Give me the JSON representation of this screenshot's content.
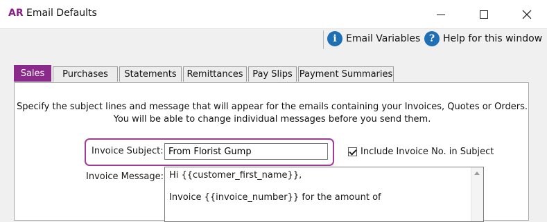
{
  "window": {
    "app_logo": "AR",
    "title": "Email Defaults"
  },
  "toolbar": {
    "email_variables_label": "Email Variables",
    "email_variables_icon": "info-icon",
    "help_label": "Help for this window",
    "help_icon": "question-icon"
  },
  "tabs": [
    {
      "label": "Sales",
      "active": true
    },
    {
      "label": "Purchases"
    },
    {
      "label": "Statements"
    },
    {
      "label": "Remittances"
    },
    {
      "label": "Pay Slips"
    },
    {
      "label": "Payment Summaries"
    }
  ],
  "sales": {
    "intro_line1": "Specify the subject lines and message that will appear for the emails containing your Invoices, Quotes or Orders.",
    "intro_line2": "You will be able to change individual messages before you send them.",
    "subject_label": "Invoice Subject:",
    "subject_value": "From Florist Gump",
    "include_invoice_no_label": "Include Invoice No. in Subject",
    "include_invoice_no_checked": true,
    "message_label": "Invoice Message:",
    "message_line1": "Hi {{customer_first_name}},",
    "message_line2": "Invoice {{invoice_number}} for the amount of"
  },
  "colors": {
    "accent": "#8a2a8a",
    "highlight": "#a23a94",
    "info_blue": "#1f6fb4"
  }
}
